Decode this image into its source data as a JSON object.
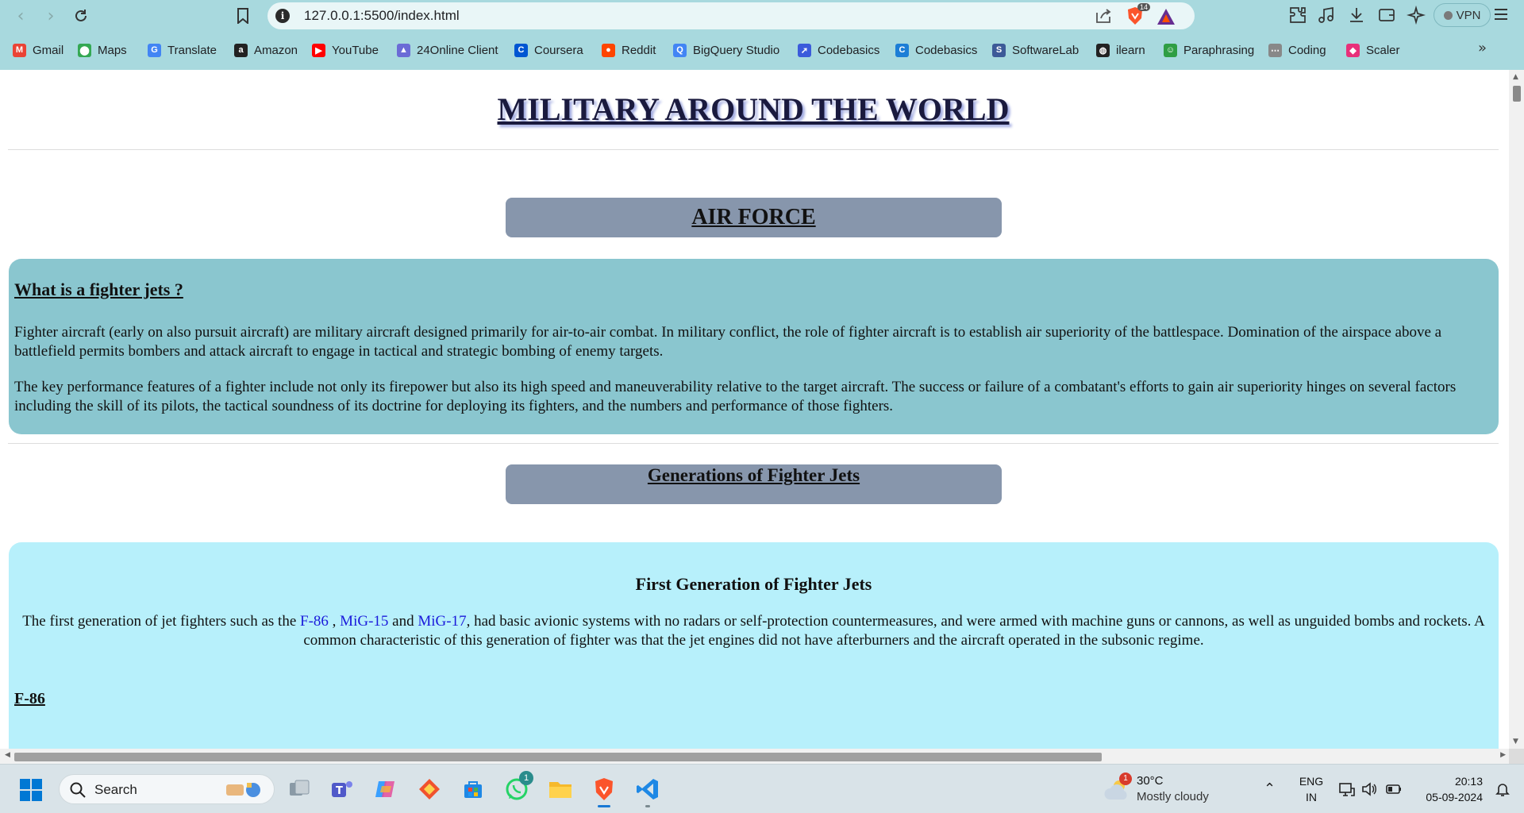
{
  "browser": {
    "url": "127.0.0.1:5500/index.html",
    "vpn_label": "VPN",
    "brave_badge": "14",
    "bookmarks": [
      {
        "label": "Gmail",
        "icon": "gmail-icon",
        "color": "#ea4335"
      },
      {
        "label": "Maps",
        "icon": "maps-icon",
        "color": "#34a853"
      },
      {
        "label": "Translate",
        "icon": "translate-icon",
        "color": "#4285f4"
      },
      {
        "label": "Amazon",
        "icon": "amazon-icon",
        "color": "#222222"
      },
      {
        "label": "YouTube",
        "icon": "youtube-icon",
        "color": "#ff0000"
      },
      {
        "label": "24Online Client",
        "icon": "24online-icon",
        "color": "#6b6bd6"
      },
      {
        "label": "Coursera",
        "icon": "coursera-icon",
        "color": "#0056d2"
      },
      {
        "label": "Reddit",
        "icon": "reddit-icon",
        "color": "#ff4500"
      },
      {
        "label": "BigQuery Studio",
        "icon": "bigquery-icon",
        "color": "#4285f4"
      },
      {
        "label": "Codebasics",
        "icon": "codebasics-rocket-icon",
        "color": "#3b5bdb"
      },
      {
        "label": "Codebasics",
        "icon": "codebasics-icon",
        "color": "#1c7ed6"
      },
      {
        "label": "SoftwareLab",
        "icon": "softwarelab-icon",
        "color": "#3d5a98"
      },
      {
        "label": "ilearn",
        "icon": "globe-icon",
        "color": "#222222"
      },
      {
        "label": "Paraphrasing",
        "icon": "paraphrasing-icon",
        "color": "#2f9e44"
      },
      {
        "label": "Coding",
        "icon": "coding-icon",
        "color": "#888888"
      },
      {
        "label": "Scaler",
        "icon": "scaler-icon",
        "color": "#e8307a"
      }
    ]
  },
  "page": {
    "title": "MILITARY AROUND THE WORLD",
    "air_force_banner": "AIR FORCE",
    "intro": {
      "heading": "What is a fighter jets ?",
      "p1": "Fighter aircraft (early on also pursuit aircraft) are military aircraft designed primarily for air-to-air combat. In military conflict, the role of fighter aircraft is to establish air superiority of the battlespace. Domination of the airspace above a battlefield permits bombers and attack aircraft to engage in tactical and strategic bombing of enemy targets.",
      "p2": "The key performance features of a fighter include not only its firepower but also its high speed and maneuverability relative to the target aircraft. The success or failure of a combatant's efforts to gain air superiority hinges on several factors including the skill of its pilots, the tactical soundness of its doctrine for deploying its fighters, and the numbers and performance of those fighters."
    },
    "generations_banner": "Generations of Fighter Jets",
    "first_gen": {
      "title": "First Generation of Fighter Jets",
      "text_before": "The first generation of jet fighters such as the ",
      "link1": "F-86",
      "sep1": " , ",
      "link2": "MiG-15",
      "sep2": " and ",
      "link3": "MiG-17",
      "text_after": ", had basic avionic systems with no radars or self-protection countermeasures, and were armed with machine guns or cannons, as well as unguided bombs and rockets. A common characteristic of this generation of fighter was that the jet engines did not have afterburners and the aircraft operated in the subsonic regime.",
      "f86_heading": "F-86"
    },
    "colors": {
      "intro_box": "#8ac6cf",
      "gen_box": "#b7f0fb",
      "banner": "#8796ac",
      "link": "#1a1adb"
    }
  },
  "taskbar": {
    "search_placeholder": "Search",
    "whatsapp_badge": "1",
    "weather": {
      "temp": "30°C",
      "condition": "Mostly cloudy",
      "badge": "1"
    },
    "lang_line1": "ENG",
    "lang_line2": "IN",
    "time": "20:13",
    "date": "05-09-2024"
  }
}
